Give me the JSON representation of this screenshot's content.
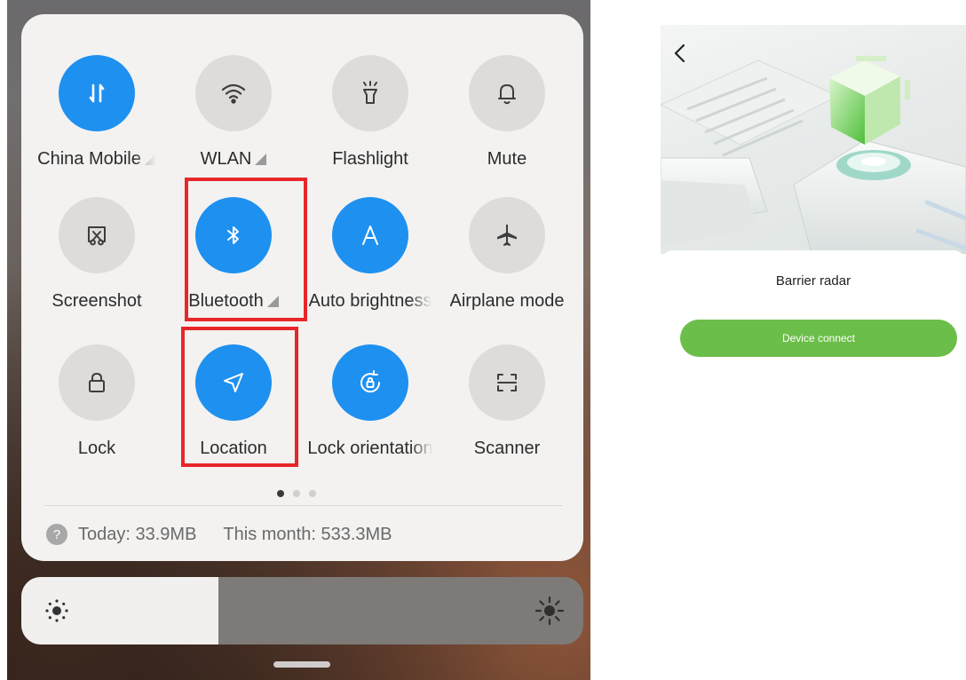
{
  "control_center": {
    "tiles": [
      {
        "label": "China Mobile",
        "icon": "mobile-data-icon",
        "state": "on",
        "has_menu": true
      },
      {
        "label": "WLAN",
        "icon": "wifi-icon",
        "state": "off",
        "has_menu": true
      },
      {
        "label": "Flashlight",
        "icon": "flashlight-icon",
        "state": "off",
        "has_menu": false
      },
      {
        "label": "Mute",
        "icon": "bell-icon",
        "state": "off",
        "has_menu": false
      },
      {
        "label": "Screenshot",
        "icon": "screenshot-icon",
        "state": "off",
        "has_menu": false
      },
      {
        "label": "Bluetooth",
        "icon": "bluetooth-icon",
        "state": "on",
        "has_menu": true
      },
      {
        "label": "Auto brightness",
        "icon": "auto-brightness-icon",
        "state": "on",
        "has_menu": false
      },
      {
        "label": "Airplane mode",
        "icon": "airplane-icon",
        "state": "off",
        "has_menu": false
      },
      {
        "label": "Lock",
        "icon": "lock-icon",
        "state": "off",
        "has_menu": false
      },
      {
        "label": "Location",
        "icon": "location-icon",
        "state": "on",
        "has_menu": false
      },
      {
        "label": "Lock orientation",
        "icon": "rotation-lock-icon",
        "state": "on",
        "has_menu": false
      },
      {
        "label": "Scanner",
        "icon": "scanner-icon",
        "state": "off",
        "has_menu": false
      }
    ],
    "page_indicator": {
      "pages": 3,
      "active": 1
    },
    "usage": {
      "today": "Today: 33.9MB",
      "month": "This month: 533.3MB"
    },
    "brightness": {
      "level": 0.35
    }
  },
  "colors": {
    "accent_blue": "#1e90f0",
    "highlight_red": "#e8262a",
    "connect_green": "#6cbe4a"
  },
  "app": {
    "title": "Barrier radar",
    "connect_label": "Device connect"
  }
}
